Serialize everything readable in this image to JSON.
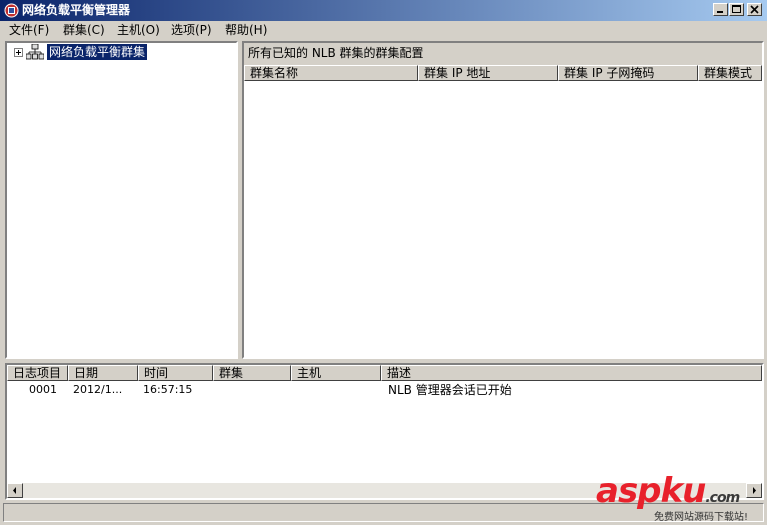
{
  "window": {
    "title": "网络负载平衡管理器"
  },
  "menubar": {
    "items": [
      {
        "id": "file",
        "label": "文件(F)"
      },
      {
        "id": "cluster",
        "label": "群集(C)"
      },
      {
        "id": "host",
        "label": "主机(O)"
      },
      {
        "id": "options",
        "label": "选项(P)"
      },
      {
        "id": "help",
        "label": "帮助(H)"
      }
    ]
  },
  "tree": {
    "root_label": "网络负载平衡群集"
  },
  "config_panel": {
    "title": "所有已知的 NLB 群集的群集配置",
    "columns": [
      "群集名称",
      "群集 IP 地址",
      "群集 IP 子网掩码",
      "群集模式"
    ]
  },
  "log": {
    "columns": [
      "日志项目",
      "日期",
      "时间",
      "群集",
      "主机",
      "描述"
    ],
    "rows": [
      {
        "entry": "0001",
        "date": "2012/1...",
        "time": "16:57:15",
        "cluster": "",
        "host": "",
        "description": "NLB 管理器会话已开始"
      }
    ]
  },
  "watermark": {
    "brand": "aspku",
    "tld": ".com",
    "slogan": "免费网站源码下载站!"
  },
  "colors": {
    "titlebar_start": "#0a246a",
    "titlebar_end": "#a6caf0",
    "selection": "#0a246a",
    "face": "#d4d0c8",
    "watermark_red": "#e8212b"
  }
}
